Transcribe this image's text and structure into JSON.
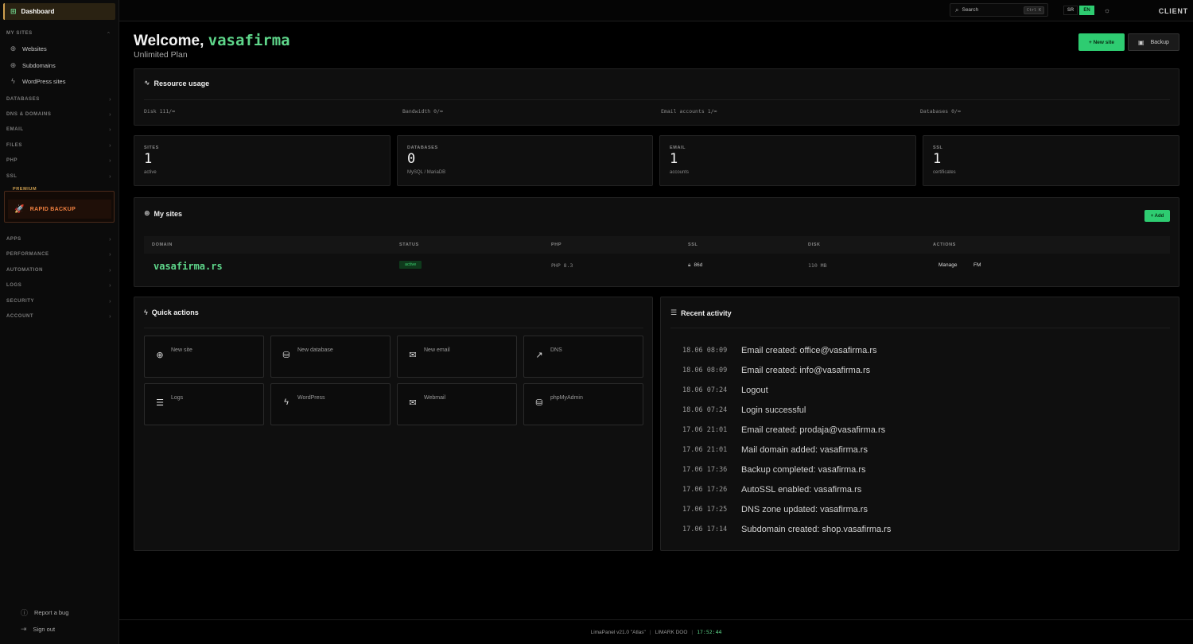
{
  "sidebar": {
    "dashboard": "Dashboard",
    "my_sites": "MY SITES",
    "websites": "Websites",
    "subdomains": "Subdomains",
    "wordpress_sites": "WordPress sites",
    "sections1": [
      "DATABASES",
      "DNS & DOMAINS",
      "EMAIL",
      "FILES",
      "PHP",
      "SSL"
    ],
    "premium_label": "PREMIUM",
    "rapid_backup": "RAPID BACKUP",
    "sections2": [
      "APPS",
      "PERFORMANCE",
      "AUTOMATION",
      "LOGS",
      "SECURITY",
      "ACCOUNT"
    ],
    "report_bug": "Report a bug",
    "sign_out": "Sign out"
  },
  "topbar": {
    "search_placeholder": "Search",
    "shortcut": "Ctrl K",
    "lang_sr": "SR",
    "lang_en": "EN",
    "role": "CLIENT"
  },
  "header": {
    "welcome": "Welcome,",
    "username": "vasafirma",
    "plan": "Unlimited Plan",
    "new_site": "+ New site",
    "backup": "Backup"
  },
  "resource_usage": {
    "title": "Resource usage",
    "items": [
      "Disk 111/∞",
      "Bandwidth 0/∞",
      "Email accounts 1/∞",
      "Databases 0/∞"
    ]
  },
  "stats": [
    {
      "label": "SITES",
      "value": "1",
      "sub": "active"
    },
    {
      "label": "DATABASES",
      "value": "0",
      "sub": "MySQL / MariaDB"
    },
    {
      "label": "EMAIL",
      "value": "1",
      "sub": "accounts"
    },
    {
      "label": "SSL",
      "value": "1",
      "sub": "certificates"
    }
  ],
  "my_sites": {
    "title": "My sites",
    "add": "+ Add",
    "columns": [
      "DOMAIN",
      "STATUS",
      "PHP",
      "SSL",
      "DISK",
      "ACTIONS"
    ],
    "rows": [
      {
        "domain": "vasafirma.rs",
        "status": "active",
        "php": "PHP 8.3",
        "ssl": "86d",
        "disk": "110 MB",
        "manage": "Manage",
        "fm": "FM"
      }
    ]
  },
  "quick_actions": {
    "title": "Quick actions",
    "items": [
      {
        "label": "New site",
        "icon": "globe-icon"
      },
      {
        "label": "New database",
        "icon": "database-icon"
      },
      {
        "label": "New email",
        "icon": "mail-icon"
      },
      {
        "label": "DNS",
        "icon": "external-link-icon"
      },
      {
        "label": "Logs",
        "icon": "list-icon"
      },
      {
        "label": "WordPress",
        "icon": "bolt-icon"
      },
      {
        "label": "Webmail",
        "icon": "mail-icon"
      },
      {
        "label": "phpMyAdmin",
        "icon": "database-icon"
      }
    ]
  },
  "recent_activity": {
    "title": "Recent activity",
    "items": [
      {
        "time": "18.06 08:09",
        "msg": "Email created: office@vasafirma.rs"
      },
      {
        "time": "18.06 08:09",
        "msg": "Email created: info@vasafirma.rs"
      },
      {
        "time": "18.06 07:24",
        "msg": "Logout"
      },
      {
        "time": "18.06 07:24",
        "msg": "Login successful"
      },
      {
        "time": "17.06 21:01",
        "msg": "Email created: prodaja@vasafirma.rs"
      },
      {
        "time": "17.06 21:01",
        "msg": "Mail domain added: vasafirma.rs"
      },
      {
        "time": "17.06 17:36",
        "msg": "Backup completed: vasafirma.rs"
      },
      {
        "time": "17.06 17:26",
        "msg": "AutoSSL enabled: vasafirma.rs"
      },
      {
        "time": "17.06 17:25",
        "msg": "DNS zone updated: vasafirma.rs"
      },
      {
        "time": "17.06 17:14",
        "msg": "Subdomain created: shop.vasafirma.rs"
      }
    ]
  },
  "footer": {
    "version": "LimaPanel v21.0 \"Atlas\"",
    "sep": "|",
    "company": "LIMARK DOO",
    "time": "17:52:44"
  },
  "colors": {
    "accent": "#2ecc71",
    "premium": "#f08040"
  }
}
